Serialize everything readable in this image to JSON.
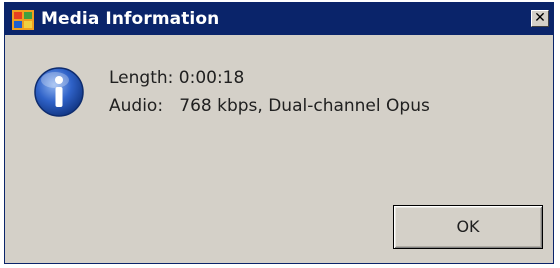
{
  "window": {
    "title": "Media Information",
    "close_glyph": "✕",
    "app_icon": "windows-media-app-icon"
  },
  "message": {
    "icon": "information-icon",
    "length_label": "Length:",
    "length_value": "0:00:18",
    "audio_label": "Audio:",
    "audio_value": "768 kbps, Dual-channel Opus"
  },
  "buttons": {
    "ok_label": "OK"
  },
  "colors": {
    "titlebar": "#0a246a",
    "dialog_face": "#d4d0c8",
    "info_icon": "#2456b4"
  }
}
